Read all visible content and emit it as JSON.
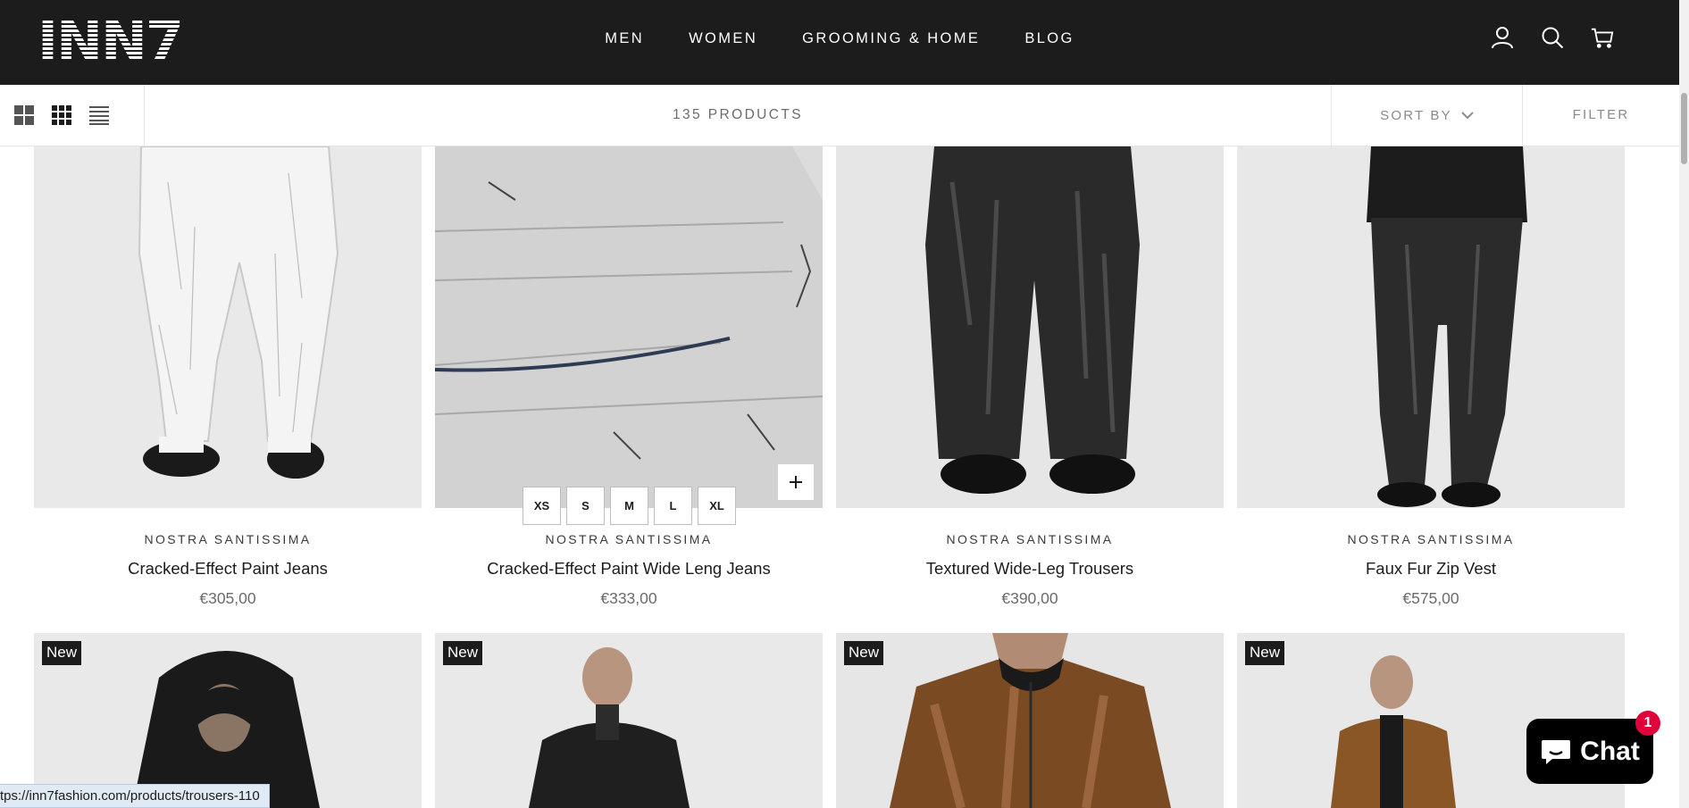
{
  "header": {
    "logo_text": "INN7",
    "nav": [
      "MEN",
      "WOMEN",
      "GROOMING & HOME",
      "BLOG"
    ]
  },
  "toolbar": {
    "product_count": "135 PRODUCTS",
    "sort_label": "SORT BY",
    "filter_label": "FILTER"
  },
  "products_row1": [
    {
      "brand": "NOSTRA SANTISSIMA",
      "title": "Cracked-Effect Paint Jeans",
      "price": "€305,00"
    },
    {
      "brand": "NOSTRA SANTISSIMA",
      "title": "Cracked-Effect Paint Wide Leng Jeans",
      "price": "€333,00"
    },
    {
      "brand": "NOSTRA SANTISSIMA",
      "title": "Textured Wide-Leg Trousers",
      "price": "€390,00"
    },
    {
      "brand": "NOSTRA SANTISSIMA",
      "title": "Faux Fur Zip Vest",
      "price": "€575,00"
    }
  ],
  "products_row2": [
    {
      "badge": "New"
    },
    {
      "badge": "New"
    },
    {
      "badge": "New"
    },
    {
      "badge": "New"
    }
  ],
  "size_options": [
    "XS",
    "S",
    "M",
    "L",
    "XL"
  ],
  "status_url": "tps://inn7fashion.com/products/trousers-110",
  "chat": {
    "label": "Chat",
    "badge_count": "1"
  },
  "colors": {
    "header_bg": "#1c1c1c",
    "chat_badge": "#e0003a",
    "status_bg": "#dfeaf5"
  }
}
